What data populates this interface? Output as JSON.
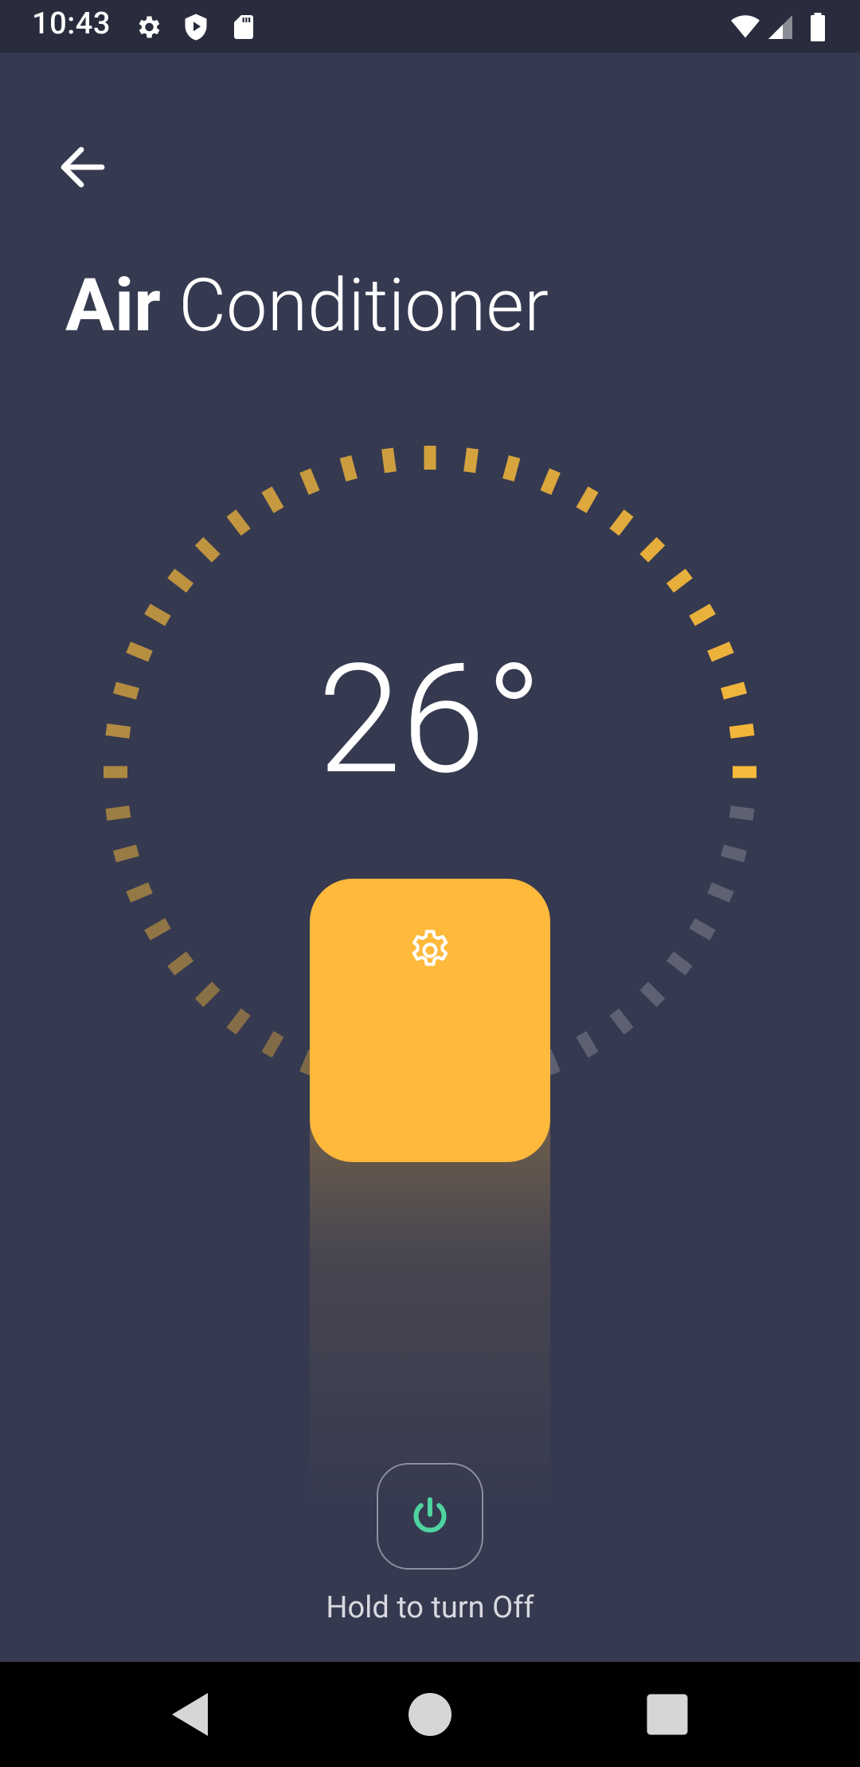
{
  "status_bar": {
    "time": "10:43",
    "left_icons": [
      "settings-icon",
      "shield-play-icon",
      "sd-card-icon"
    ],
    "right_icons": [
      "wifi-icon",
      "cell-signal-icon",
      "battery-icon"
    ]
  },
  "header": {
    "back_icon": "arrow-left-icon",
    "title_bold": "Air",
    "title_light": " Conditioner"
  },
  "thermostat": {
    "temperature": "26°",
    "dial_ticks_total": 48,
    "dial_level_fraction": 0.5,
    "active_color": "#f6b93b",
    "inactive_color": "#5e6172"
  },
  "slider": {
    "handle_icon": "gear-icon",
    "handle_color": "#ffb93b"
  },
  "power": {
    "icon": "power-icon",
    "icon_color": "#4fd3a0",
    "label": "Hold to turn Off"
  },
  "nav_bar": {
    "buttons": [
      "back-triangle-icon",
      "home-circle-icon",
      "recents-square-icon"
    ]
  },
  "colors": {
    "background": "#363a50",
    "status_bar": "#292c3c",
    "accent": "#ffb93b"
  }
}
